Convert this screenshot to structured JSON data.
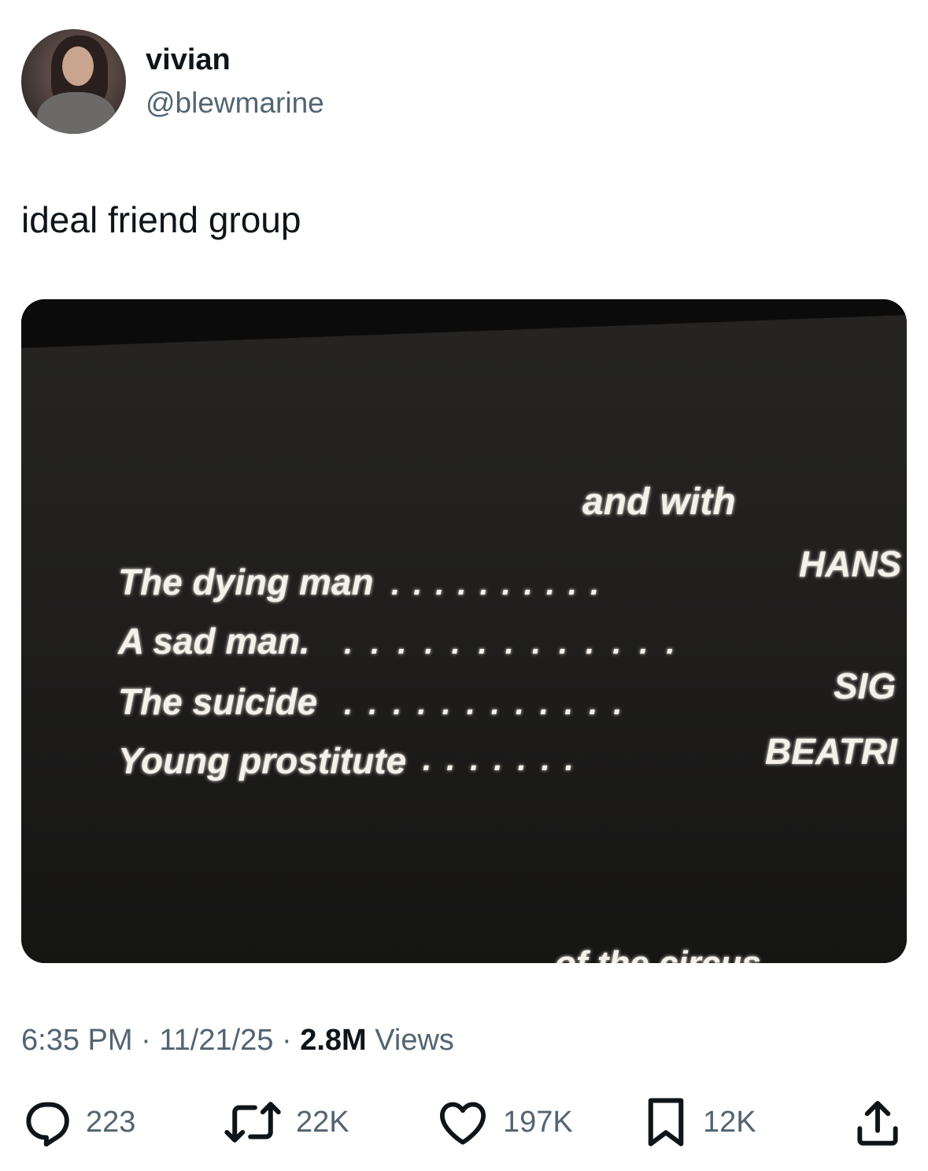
{
  "author": {
    "display_name": "vivian",
    "handle": "@blewmarine",
    "avatar_icon": "profile-photo"
  },
  "tweet": {
    "text": "ideal friend group"
  },
  "media": {
    "heading": "and with",
    "credits": [
      {
        "role": "The dying man",
        "name": "HANS"
      },
      {
        "role": "A sad man.",
        "name": ""
      },
      {
        "role": "The suicide",
        "name": "SIG"
      },
      {
        "role": "Young prostitute",
        "name": "BEATRI"
      }
    ],
    "bottom_text": "of the circus"
  },
  "meta": {
    "time": "6:35 PM",
    "separator": "·",
    "date": "11/21/25",
    "views_count": "2.8M",
    "views_label": "Views"
  },
  "actions": {
    "replies": {
      "icon": "reply-icon",
      "count": "223"
    },
    "reposts": {
      "icon": "repost-icon",
      "count": "22K"
    },
    "likes": {
      "icon": "heart-icon",
      "count": "197K"
    },
    "bookmarks": {
      "icon": "bookmark-icon",
      "count": "12K"
    },
    "share": {
      "icon": "share-icon"
    }
  },
  "colors": {
    "text_primary": "#0f1419",
    "text_secondary": "#536471",
    "media_background": "#1e1d1c",
    "credit_text": "#f4f1ea"
  }
}
